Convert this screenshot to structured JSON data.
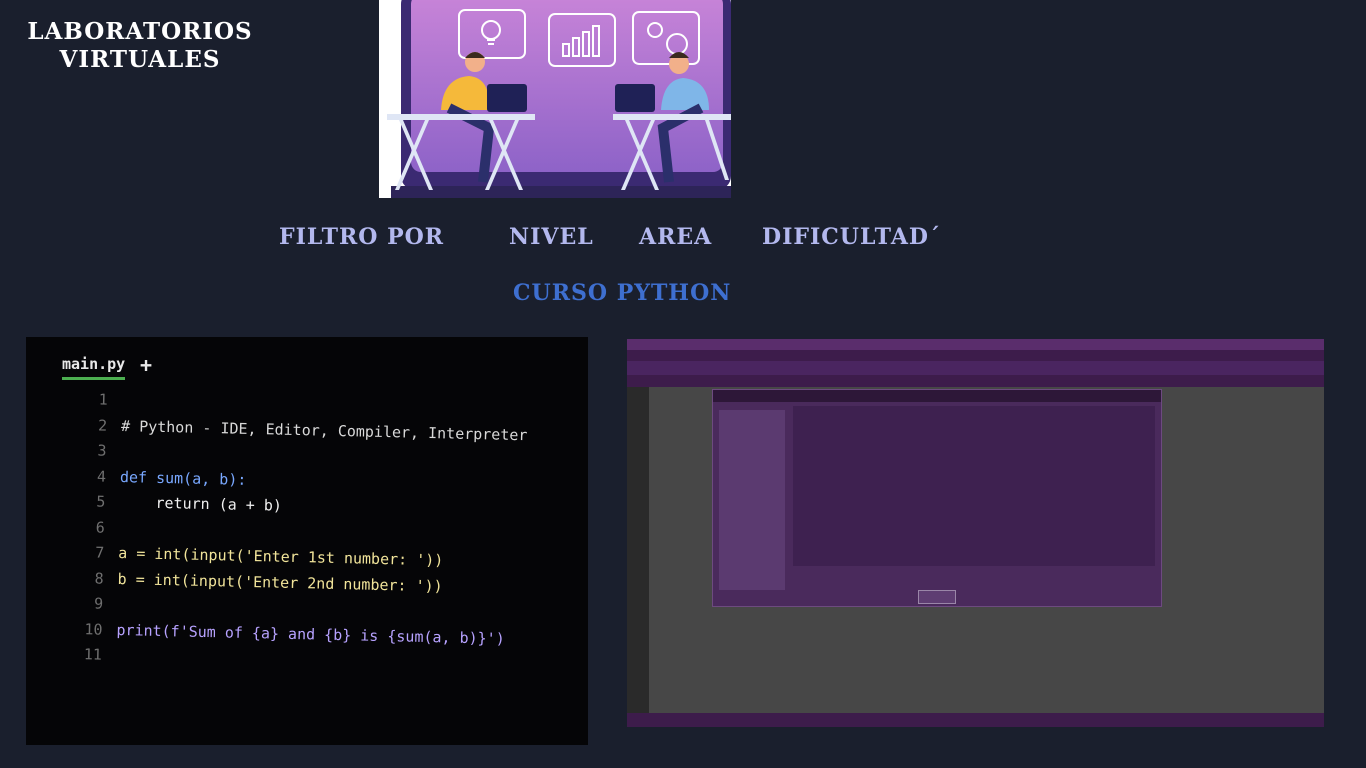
{
  "brand": {
    "line1": "LABORATORIOS",
    "line2": "VIRTUALES"
  },
  "filters": {
    "label": "FILTRO POR",
    "options": [
      "NIVEL",
      "AREA",
      "DIFICULTAD´"
    ]
  },
  "course": {
    "title": "CURSO PYTHON"
  },
  "editor": {
    "tab": "main.py",
    "add_tab": "+",
    "lines": [
      {
        "n": "1",
        "code": ""
      },
      {
        "n": "2",
        "code": "# Python - IDE, Editor, Compiler, Interpreter"
      },
      {
        "n": "3",
        "code": ""
      },
      {
        "n": "4",
        "code": "def sum(a, b):"
      },
      {
        "n": "5",
        "code": "    return (a + b)"
      },
      {
        "n": "6",
        "code": ""
      },
      {
        "n": "7",
        "code": "a = int(input('Enter 1st number: '))"
      },
      {
        "n": "8",
        "code": "b = int(input('Enter 2nd number: '))"
      },
      {
        "n": "9",
        "code": ""
      },
      {
        "n": "10",
        "code": "print(f'Sum of {a} and {b} is {sum(a, b)}')"
      },
      {
        "n": "11",
        "code": ""
      }
    ]
  },
  "colors": {
    "background": "#1a1f2d",
    "filter_text": "#b3b8ee",
    "course_title": "#3e6fd0",
    "ide_accent": "#4a2560"
  }
}
